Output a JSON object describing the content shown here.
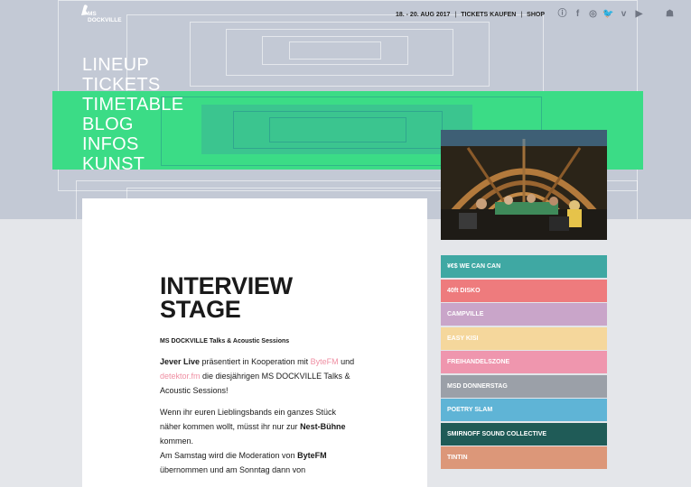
{
  "logo": {
    "line1": "MS",
    "line2": "DOCKVILLE"
  },
  "topbar": {
    "date": "18. - 20. AUG 2017",
    "tickets": "TICKETS KAUFEN",
    "shop": "SHOP",
    "social_icons": [
      "info-icon",
      "facebook-icon",
      "instagram-icon",
      "twitter-icon",
      "vimeo-icon",
      "youtube-icon",
      "apple-icon",
      "android-icon"
    ]
  },
  "nav": [
    "LINEUP",
    "TICKETS",
    "TIMETABLE",
    "BLOG",
    "INFOS",
    "KUNST"
  ],
  "article": {
    "title": "INTERVIEW\nSTAGE",
    "subtitle": "MS DOCKVILLE Talks & Acoustic Sessions",
    "p1_bold": "Jever Live",
    "p1_text1": " präsentiert in Kooperation mit ",
    "p1_link1": "ByteFM",
    "p1_text2": " und ",
    "p1_link2": "detektor.fm",
    "p1_text3": " die diesjährigen MS DOCKVILLE Talks & Acoustic Sessions!",
    "p2_text1": "Wenn ihr euren Lieblingsbands ein ganzes Stück näher kommen wollt, müsst ihr nur zur ",
    "p2_bold": "Nest-Bühne",
    "p2_text2": " kommen.",
    "p3_text1": "Am Samstag wird die Moderation von ",
    "p3_bold": "ByteFM",
    "p3_text2": " übernommen und am Sonntag dann von"
  },
  "stages": [
    {
      "label": "¥€$ WE CAN CAN",
      "color": "#3fa8a3"
    },
    {
      "label": "40ft DISKO",
      "color": "#ee7b7d"
    },
    {
      "label": "CAMPVILLE",
      "color": "#c9a5c9"
    },
    {
      "label": "EASY KISI",
      "color": "#f5d79c"
    },
    {
      "label": "FREIHANDELSZONE",
      "color": "#ef96ae"
    },
    {
      "label": "MSD DONNERSTAG",
      "color": "#9ba0a8"
    },
    {
      "label": "POETRY SLAM",
      "color": "#5fb4d6"
    },
    {
      "label": "SMIRNOFF SOUND COLLECTIVE",
      "color": "#1f5b57"
    },
    {
      "label": "TINTIN",
      "color": "#dc9779"
    }
  ],
  "colors": {
    "accent_green": "#3bdc86",
    "hero_bg": "#c3c9d5",
    "link_pink": "#ef8fa3"
  }
}
